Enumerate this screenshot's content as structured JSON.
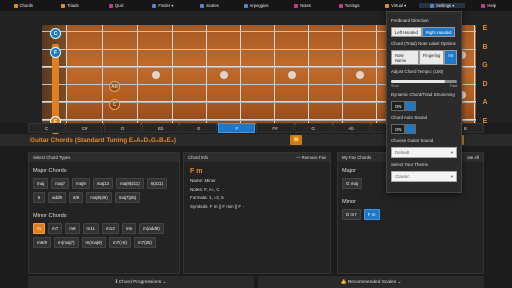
{
  "nav": {
    "items": [
      {
        "label": "Chords",
        "icon": "guitar-icon",
        "color": "#e58a2d"
      },
      {
        "label": "Triads",
        "icon": "music-note-icon",
        "color": "#e58a2d"
      },
      {
        "label": "Quiz",
        "icon": "gift-icon",
        "color": "#c83a8a"
      },
      {
        "label": "Finder ▾",
        "icon": "search-icon",
        "color": "#4a8ad0"
      },
      {
        "label": "Scales",
        "icon": "notes-icon",
        "color": "#4a8ad0"
      },
      {
        "label": "Arpeggios",
        "icon": "music-icon",
        "color": "#4a8ad0"
      },
      {
        "label": "Notes",
        "icon": "music-note-icon",
        "color": "#c83a8a"
      },
      {
        "label": "Tunings",
        "icon": "tuning-icon",
        "color": "#c83a8a"
      },
      {
        "label": "Virtual ▾",
        "icon": "guitar-icon",
        "color": "#e58a2d"
      },
      {
        "label": "Settings ▾",
        "icon": "gear-icon",
        "color": "#4a8ad0"
      },
      {
        "label": "Help",
        "icon": "question-icon",
        "color": "#c83a8a"
      }
    ]
  },
  "fretboard": {
    "tuning": [
      "E",
      "B",
      "G",
      "D",
      "A",
      "E"
    ],
    "markers": [
      {
        "label": "C",
        "style": "blue"
      },
      {
        "label": "F",
        "style": "blue"
      },
      {
        "label": "Ab",
        "style": "ring"
      },
      {
        "label": "C",
        "style": "ring"
      },
      {
        "label": "F",
        "style": "root"
      }
    ]
  },
  "keys": [
    "C",
    "C#",
    "D",
    "Eb",
    "E",
    "F",
    "F#",
    "G",
    "Ab",
    "A",
    "Bb",
    "B"
  ],
  "active_key": "F",
  "chord_strip": {
    "title": "Guitar Chords (Standard Tuning E₂A₂D₃G₃B₃E₄)",
    "prev_icon": "⏪",
    "next_icon": "⏩"
  },
  "left_panel": {
    "header": "Select Chord Types",
    "major_title": "Major Chords",
    "major": [
      "maj",
      "maj7",
      "maj9",
      "maj13",
      "maj9(♯11)",
      "6(♯11)",
      "6",
      "add9",
      "6/9",
      "maj9(♯5)",
      "maj7(♯5)"
    ],
    "minor_title": "Minor Chords",
    "minor": [
      "m",
      "m7",
      "m9",
      "m11",
      "m13",
      "m6",
      "m(add9)",
      "m6/9",
      "m(maj7)",
      "m(maj9)",
      "m7(♭5)",
      "m7(♯5)"
    ],
    "selected_minor": "m"
  },
  "info_panel": {
    "header": "Chord Info",
    "remove": "— Remove Fav",
    "name": "F m",
    "lines": [
      "Name: Minor",
      "Notes: F, A♭, C",
      "Formula: 1, ♭3, 5",
      "Symbols: F m || F min || F -"
    ]
  },
  "fav_panel": {
    "header": "My Fav Chords",
    "restore": "ate All",
    "major_title": "Major",
    "major": [
      "G maj"
    ],
    "minor_title": "Minor",
    "minor": [
      "D m7",
      "F m"
    ]
  },
  "settings_menu": {
    "direction_label": "Fretboard Direction",
    "direction_options": [
      "Left Handed",
      "Right Handed"
    ],
    "direction_selected": "Right Handed",
    "note_label_label": "Chord (Triad) Note Label Options",
    "note_label_options": [
      "Note Name",
      "Fingering",
      "Int"
    ],
    "note_label_selected": "Int",
    "tempo_label": "Adjust Chord Tempo: (100)",
    "tempo_min": "Slow",
    "tempo_max": "Fast",
    "tempo_level": 0.82,
    "strum_label": "Dynamic Chord/Triad Strumming",
    "strum_state": "ON",
    "auto_label": "Chord Auto Sound",
    "auto_state": "ON",
    "sound_label": "Choose Guitar Sound",
    "sound_value": "Default",
    "theme_label": "Select Your Theme",
    "theme_value": "Classic"
  },
  "bottom": {
    "left": "ℹ Chord Progressions ⌄",
    "right": "👍 Recommended Scales ⌄"
  }
}
